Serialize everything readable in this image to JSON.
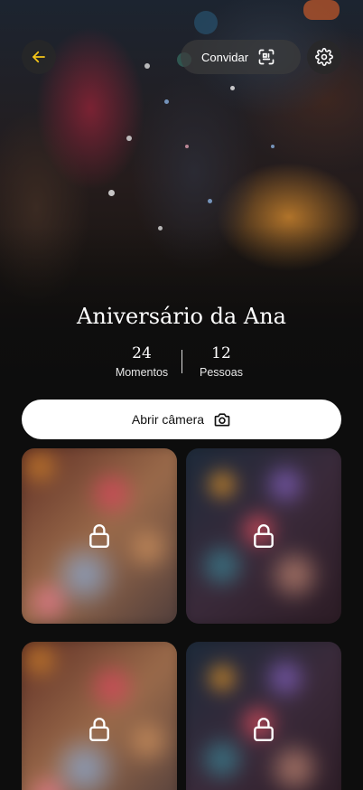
{
  "header": {
    "invite_label": "Convidar"
  },
  "event": {
    "title": "Aniversário da Ana"
  },
  "stats": {
    "moments_count": "24",
    "moments_label": "Momentos",
    "people_count": "12",
    "people_label": "Pessoas"
  },
  "actions": {
    "open_camera_label": "Abrir câmera"
  },
  "colors": {
    "accent": "#f5c518",
    "background": "#0d0d0d",
    "button_bg": "#ffffff"
  },
  "moments": [
    {
      "locked": true,
      "icon": "lock-icon"
    },
    {
      "locked": true,
      "icon": "lock-icon"
    },
    {
      "locked": true,
      "icon": "lock-icon"
    },
    {
      "locked": true,
      "icon": "lock-icon"
    }
  ]
}
